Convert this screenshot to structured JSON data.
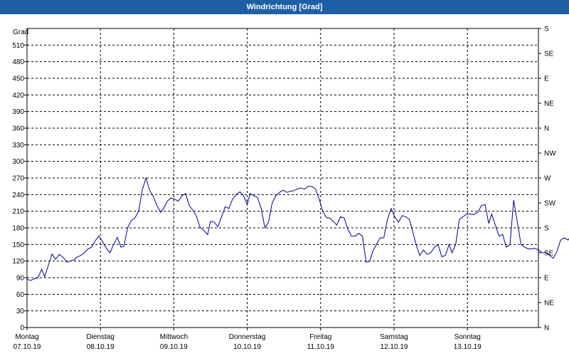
{
  "window": {
    "title": "Windrichtung [Grad]"
  },
  "chart_data": {
    "type": "line",
    "title": "Windrichtung [Grad]",
    "ylabel": "Grad",
    "ylim": [
      0,
      540
    ],
    "yticks": [
      0,
      30,
      60,
      90,
      120,
      150,
      180,
      210,
      240,
      270,
      300,
      330,
      360,
      390,
      420,
      450,
      480,
      510
    ],
    "right_axis": [
      {
        "value": 0,
        "label": "N"
      },
      {
        "value": 30,
        "label": "NE"
      },
      {
        "value": 60,
        "label": "E"
      },
      {
        "value": 90,
        "label": "SE"
      },
      {
        "value": 120,
        "label": "S"
      },
      {
        "value": 150,
        "label": "SW"
      },
      {
        "value": 180,
        "label": "W"
      },
      {
        "value": 210,
        "label": "NW"
      },
      {
        "value": 240,
        "label": "N"
      },
      {
        "value": 270,
        "label": "NE"
      },
      {
        "value": 300,
        "label": "E"
      },
      {
        "value": 330,
        "label": "SE"
      },
      {
        "value": 360,
        "label": "S"
      }
    ],
    "xlim": [
      0,
      7
    ],
    "days": [
      {
        "x": 0,
        "day": "Montag",
        "date": "07.10.19"
      },
      {
        "x": 1,
        "day": "Dienstag",
        "date": "08.10.19"
      },
      {
        "x": 2,
        "day": "Mittwoch",
        "date": "09.10.19"
      },
      {
        "x": 3,
        "day": "Donnerstag",
        "date": "10.10.19"
      },
      {
        "x": 4,
        "day": "Freitag",
        "date": "11.10.19"
      },
      {
        "x": 5,
        "day": "Samstag",
        "date": "12.10.19"
      },
      {
        "x": 6,
        "day": "Sonntag",
        "date": "13.10.19"
      }
    ],
    "grid": true,
    "line_color": "#00008b",
    "series": [
      {
        "points": [
          [
            0.0,
            87
          ],
          [
            0.05,
            85
          ],
          [
            0.1,
            88
          ],
          [
            0.15,
            90
          ],
          [
            0.2,
            105
          ],
          [
            0.24,
            92
          ],
          [
            0.29,
            112
          ],
          [
            0.34,
            133
          ],
          [
            0.39,
            123
          ],
          [
            0.44,
            132
          ],
          [
            0.49,
            127
          ],
          [
            0.54,
            118
          ],
          [
            0.59,
            120
          ],
          [
            0.64,
            122
          ],
          [
            0.68,
            127
          ],
          [
            0.73,
            130
          ],
          [
            0.78,
            135
          ],
          [
            0.83,
            142
          ],
          [
            0.88,
            145
          ],
          [
            0.93,
            157
          ],
          [
            0.98,
            165
          ],
          [
            1.03,
            155
          ],
          [
            1.08,
            143
          ],
          [
            1.13,
            135
          ],
          [
            1.18,
            150
          ],
          [
            1.23,
            163
          ],
          [
            1.28,
            145
          ],
          [
            1.32,
            147
          ],
          [
            1.37,
            180
          ],
          [
            1.42,
            193
          ],
          [
            1.47,
            198
          ],
          [
            1.52,
            210
          ],
          [
            1.57,
            248
          ],
          [
            1.62,
            270
          ],
          [
            1.67,
            248
          ],
          [
            1.72,
            237
          ],
          [
            1.77,
            220
          ],
          [
            1.82,
            208
          ],
          [
            1.86,
            215
          ],
          [
            1.91,
            228
          ],
          [
            1.96,
            234
          ],
          [
            2.01,
            232
          ],
          [
            2.06,
            228
          ],
          [
            2.11,
            238
          ],
          [
            2.16,
            242
          ],
          [
            2.21,
            220
          ],
          [
            2.26,
            212
          ],
          [
            2.31,
            200
          ],
          [
            2.36,
            180
          ],
          [
            2.41,
            175
          ],
          [
            2.46,
            168
          ],
          [
            2.5,
            192
          ],
          [
            2.55,
            190
          ],
          [
            2.6,
            182
          ],
          [
            2.65,
            200
          ],
          [
            2.7,
            218
          ],
          [
            2.75,
            215
          ],
          [
            2.8,
            232
          ],
          [
            2.85,
            240
          ],
          [
            2.9,
            245
          ],
          [
            2.95,
            238
          ],
          [
            3.0,
            222
          ],
          [
            3.04,
            242
          ],
          [
            3.09,
            238
          ],
          [
            3.14,
            235
          ],
          [
            3.19,
            215
          ],
          [
            3.24,
            180
          ],
          [
            3.29,
            190
          ],
          [
            3.34,
            225
          ],
          [
            3.39,
            238
          ],
          [
            3.44,
            244
          ],
          [
            3.49,
            248
          ],
          [
            3.54,
            244
          ],
          [
            3.58,
            246
          ],
          [
            3.63,
            247
          ],
          [
            3.68,
            250
          ],
          [
            3.73,
            252
          ],
          [
            3.78,
            250
          ],
          [
            3.83,
            255
          ],
          [
            3.88,
            255
          ],
          [
            3.93,
            250
          ],
          [
            3.98,
            232
          ],
          [
            4.03,
            210
          ],
          [
            4.08,
            198
          ],
          [
            4.12,
            198
          ],
          [
            4.17,
            192
          ],
          [
            4.22,
            185
          ],
          [
            4.27,
            200
          ],
          [
            4.32,
            198
          ],
          [
            4.37,
            178
          ],
          [
            4.42,
            165
          ],
          [
            4.47,
            165
          ],
          [
            4.52,
            170
          ],
          [
            4.57,
            165
          ],
          [
            4.62,
            118
          ],
          [
            4.67,
            120
          ],
          [
            4.71,
            138
          ],
          [
            4.76,
            150
          ],
          [
            4.81,
            162
          ],
          [
            4.86,
            162
          ],
          [
            4.91,
            195
          ],
          [
            4.96,
            215
          ],
          [
            5.01,
            200
          ],
          [
            5.06,
            190
          ],
          [
            5.11,
            202
          ],
          [
            5.16,
            200
          ],
          [
            5.21,
            195
          ],
          [
            5.25,
            175
          ],
          [
            5.3,
            150
          ],
          [
            5.35,
            130
          ],
          [
            5.4,
            140
          ],
          [
            5.45,
            132
          ],
          [
            5.5,
            135
          ],
          [
            5.55,
            145
          ],
          [
            5.6,
            150
          ],
          [
            5.65,
            128
          ],
          [
            5.7,
            130
          ],
          [
            5.75,
            150
          ],
          [
            5.79,
            135
          ],
          [
            5.84,
            150
          ],
          [
            5.89,
            195
          ],
          [
            5.94,
            200
          ],
          [
            5.99,
            205
          ],
          [
            6.04,
            205
          ],
          [
            6.09,
            204
          ],
          [
            6.14,
            208
          ],
          [
            6.19,
            220
          ],
          [
            6.24,
            222
          ],
          [
            6.29,
            188
          ],
          [
            6.33,
            205
          ],
          [
            6.38,
            185
          ],
          [
            6.43,
            165
          ],
          [
            6.48,
            168
          ],
          [
            6.53,
            145
          ],
          [
            6.58,
            150
          ],
          [
            6.63,
            230
          ],
          [
            6.68,
            190
          ],
          [
            6.73,
            150
          ],
          [
            6.78,
            145
          ],
          [
            6.83,
            142
          ],
          [
            6.87,
            142
          ],
          [
            6.92,
            143
          ],
          [
            6.97,
            140
          ],
          [
            7.02,
            135
          ],
          [
            7.07,
            135
          ],
          [
            7.12,
            130
          ],
          [
            7.17,
            125
          ],
          [
            7.22,
            138
          ],
          [
            7.27,
            158
          ],
          [
            7.32,
            162
          ],
          [
            7.37,
            158
          ],
          [
            7.41,
            165
          ],
          [
            7.46,
            175
          ],
          [
            7.51,
            172
          ],
          [
            7.56,
            175
          ],
          [
            7.61,
            178
          ],
          [
            7.66,
            190
          ],
          [
            7.71,
            200
          ],
          [
            7.76,
            240
          ]
        ]
      }
    ]
  }
}
